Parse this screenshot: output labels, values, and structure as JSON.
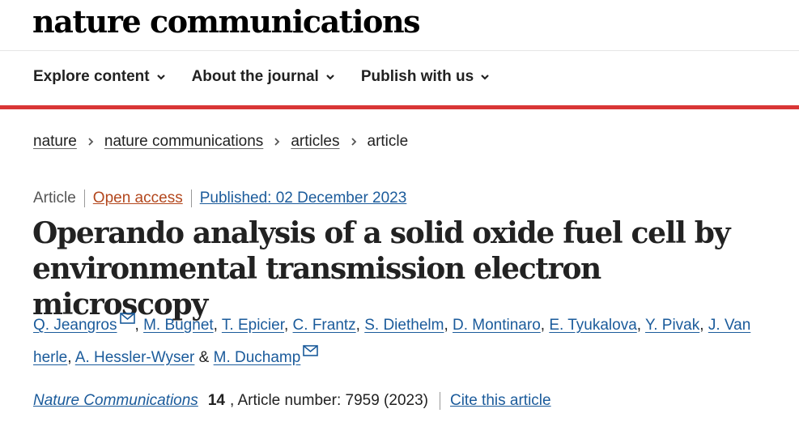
{
  "brand": {
    "name": "nature communications"
  },
  "nav": [
    {
      "label": "Explore content",
      "icon": "chevron-down-icon"
    },
    {
      "label": "About the journal",
      "icon": "chevron-down-icon"
    },
    {
      "label": "Publish with us",
      "icon": "chevron-down-icon"
    }
  ],
  "breadcrumb": [
    {
      "label": "nature",
      "link": true
    },
    {
      "label": "nature communications",
      "link": true
    },
    {
      "label": "articles",
      "link": true
    },
    {
      "label": "article",
      "link": false
    }
  ],
  "article": {
    "type": "Article",
    "access": "Open access",
    "published": "Published: 02 December 2023",
    "title": "Operando analysis of a solid oxide fuel cell by environmental transmission electron microscopy"
  },
  "authors": {
    "a1": "Q. Jeangros",
    "a2": "M. Bugnet",
    "a3": "T. Epicier",
    "a4": "C. Frantz",
    "a5": "S. Diethelm",
    "a6": "D. Montinaro",
    "a7": "E. Tyukalova",
    "a8": "Y. Pivak",
    "a9": "J. Van herle",
    "a10": "A. Hessler-Wyser",
    "a11": "M. Duchamp",
    "sep": ", ",
    "amp": " & ",
    "mail_icon": "mail-icon"
  },
  "citation": {
    "journal": "Nature Communications",
    "volume": "14",
    "article_number": ", Article number: 7959 (2023)",
    "cite_label": "Cite this article"
  },
  "colors": {
    "accent_red": "#d93636",
    "link_blue": "#1b5b9b",
    "open_access": "#b3471d"
  }
}
